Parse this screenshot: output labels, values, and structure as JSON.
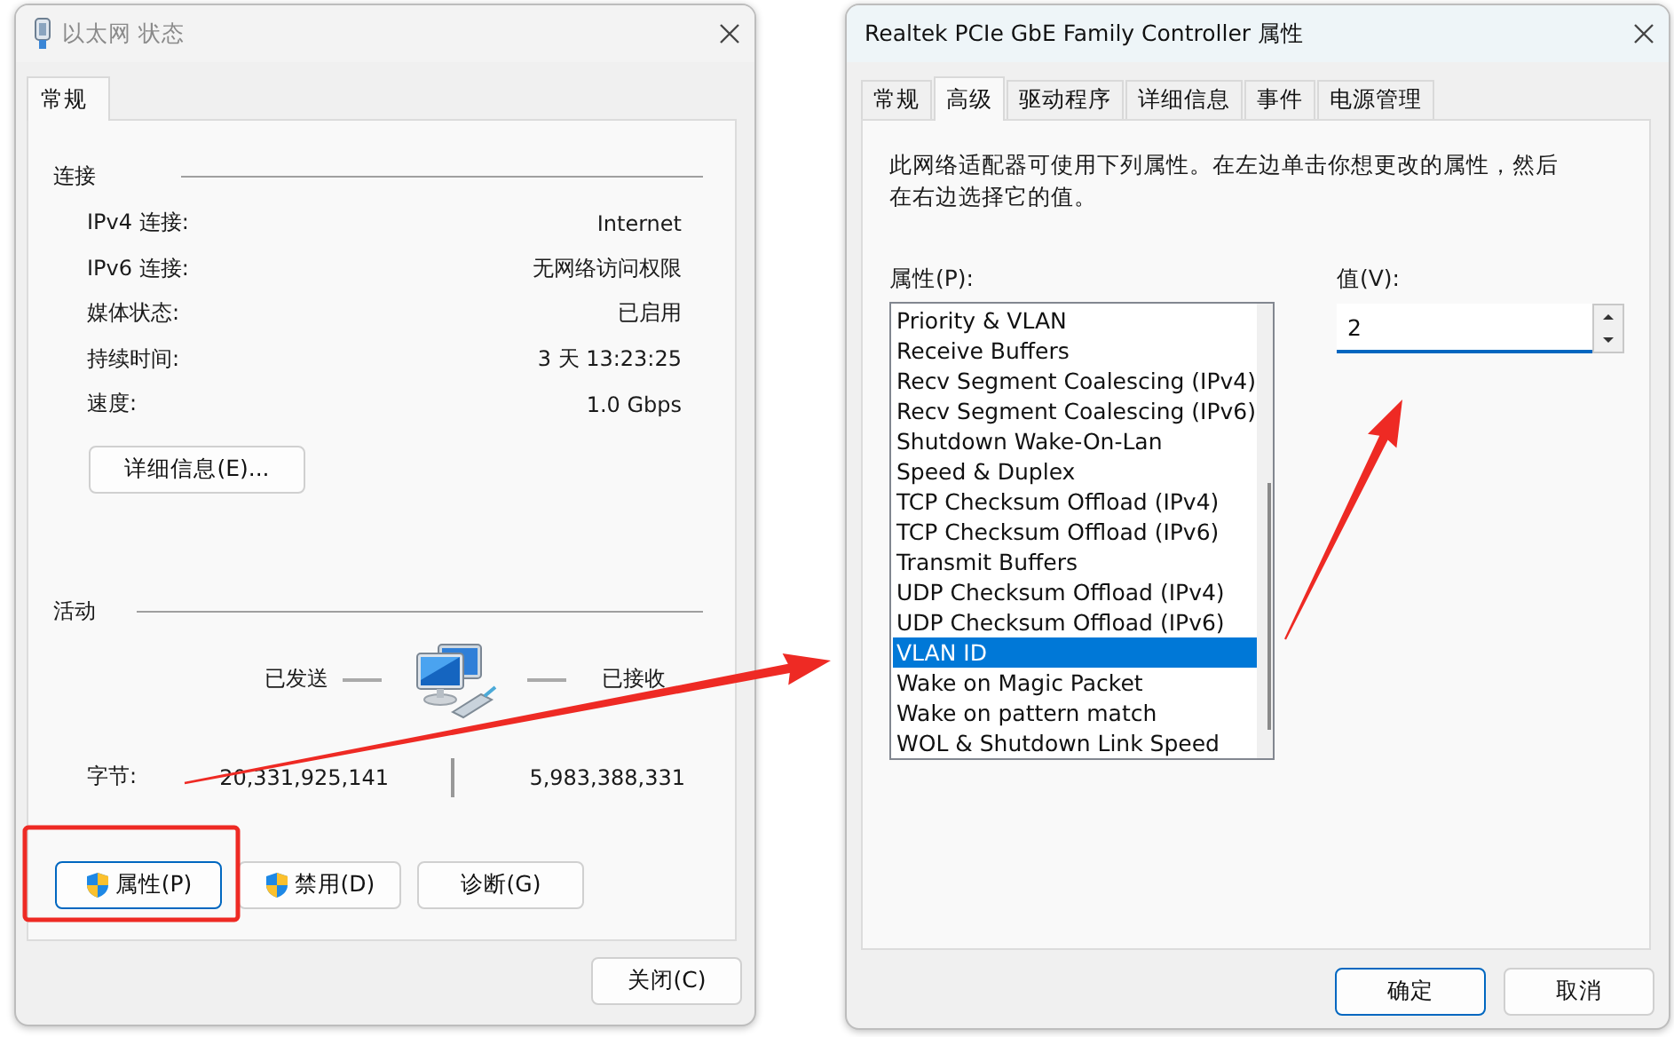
{
  "left_window": {
    "title": "以太网 状态",
    "tabs": [
      {
        "label": "常规",
        "selected": true
      }
    ],
    "connection": {
      "heading": "连接",
      "rows": [
        {
          "label": "IPv4 连接:",
          "value": "Internet"
        },
        {
          "label": "IPv6 连接:",
          "value": "无网络访问权限"
        },
        {
          "label": "媒体状态:",
          "value": "已启用"
        },
        {
          "label": "持续时间:",
          "value": "3 天 13:23:25"
        },
        {
          "label": "速度:",
          "value": "1.0 Gbps"
        }
      ]
    },
    "details_button": "详细信息(E)...",
    "activity": {
      "heading": "活动",
      "sent_label": "已发送",
      "received_label": "已接收",
      "bytes_label": "字节:",
      "bytes_sent": "20,331,925,141",
      "bytes_received": "5,983,388,331"
    },
    "buttons": [
      {
        "label": "属性(P)",
        "shield": true,
        "focused": true
      },
      {
        "label": "禁用(D)",
        "shield": true,
        "focused": false
      },
      {
        "label": "诊断(G)",
        "shield": false,
        "focused": false
      }
    ],
    "close_button": "关闭(C)"
  },
  "right_window": {
    "title": "Realtek PCIe GbE Family Controller 属性",
    "tabs": [
      {
        "label": "常规",
        "selected": false
      },
      {
        "label": "高级",
        "selected": true
      },
      {
        "label": "驱动程序",
        "selected": false
      },
      {
        "label": "详细信息",
        "selected": false
      },
      {
        "label": "事件",
        "selected": false
      },
      {
        "label": "电源管理",
        "selected": false
      }
    ],
    "description": "此网络适配器可使用下列属性。在左边单击你想更改的属性，然后在右边选择它的值。",
    "property_label": "属性(P):",
    "properties": [
      {
        "label": "Priority & VLAN",
        "selected": false
      },
      {
        "label": "Receive Buffers",
        "selected": false
      },
      {
        "label": "Recv Segment Coalescing (IPv4)",
        "selected": false
      },
      {
        "label": "Recv Segment Coalescing (IPv6)",
        "selected": false
      },
      {
        "label": "Shutdown Wake-On-Lan",
        "selected": false
      },
      {
        "label": "Speed & Duplex",
        "selected": false
      },
      {
        "label": "TCP Checksum Offload (IPv4)",
        "selected": false
      },
      {
        "label": "TCP Checksum Offload (IPv6)",
        "selected": false
      },
      {
        "label": "Transmit Buffers",
        "selected": false
      },
      {
        "label": "UDP Checksum Offload (IPv4)",
        "selected": false
      },
      {
        "label": "UDP Checksum Offload (IPv6)",
        "selected": false
      },
      {
        "label": "VLAN ID",
        "selected": true
      },
      {
        "label": "Wake on Magic Packet",
        "selected": false
      },
      {
        "label": "Wake on pattern match",
        "selected": false
      },
      {
        "label": "WOL & Shutdown Link Speed",
        "selected": false
      }
    ],
    "value_label": "值(V):",
    "value": "2",
    "buttons": [
      {
        "label": "确定",
        "default": true
      },
      {
        "label": "取消",
        "default": false
      }
    ]
  },
  "annotations": [
    {
      "kind": "box"
    },
    {
      "kind": "arrow"
    },
    {
      "kind": "arrow"
    }
  ]
}
